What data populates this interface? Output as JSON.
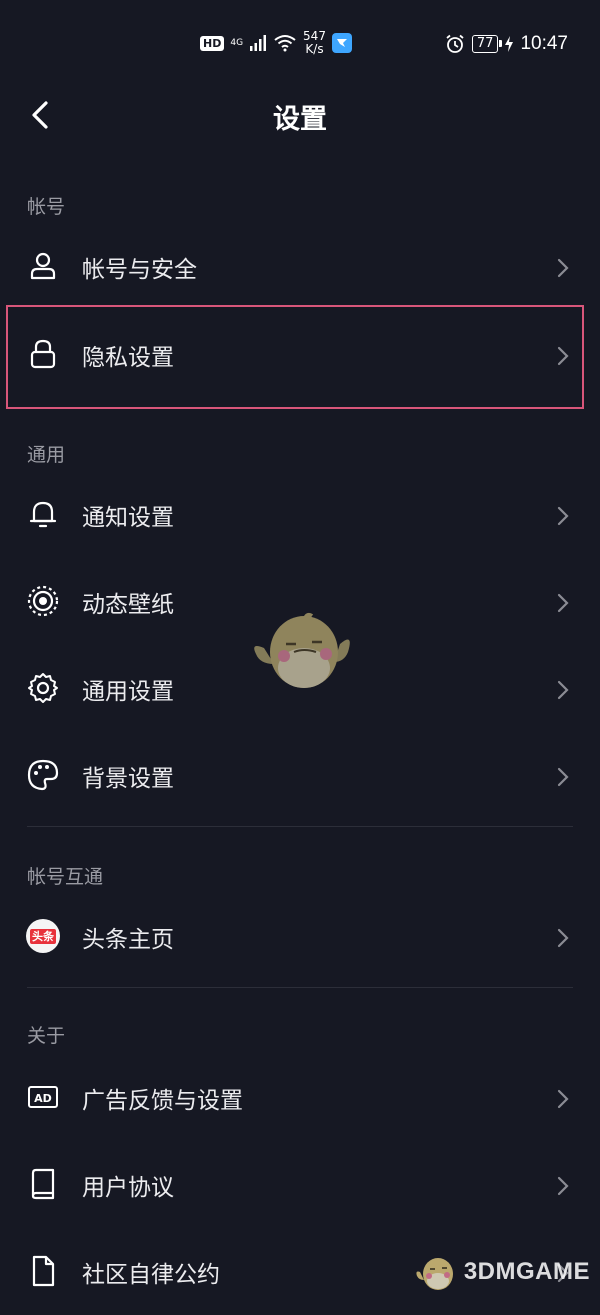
{
  "status_bar": {
    "hd": "HD",
    "network": "4G",
    "speed_value": "547",
    "speed_unit": "K/s",
    "battery": "77",
    "time": "10:47"
  },
  "header": {
    "title": "设置"
  },
  "sections": {
    "account": "帐号",
    "general": "通用",
    "linked": "帐号互通",
    "about": "关于"
  },
  "items": {
    "account_security": "帐号与安全",
    "privacy": "隐私设置",
    "notifications": "通知设置",
    "live_wallpaper": "动态壁纸",
    "general_settings": "通用设置",
    "background": "背景设置",
    "toutiao_home": "头条主页",
    "ad_feedback": "广告反馈与设置",
    "user_agreement": "用户协议",
    "community_rules": "社区自律公约"
  },
  "badges": {
    "toutiao": "头条",
    "ad": "AD"
  },
  "watermark": "3DMGAME",
  "colors": {
    "background": "#161823",
    "highlight_border": "#d8567a",
    "toutiao_red": "#e8323c"
  }
}
